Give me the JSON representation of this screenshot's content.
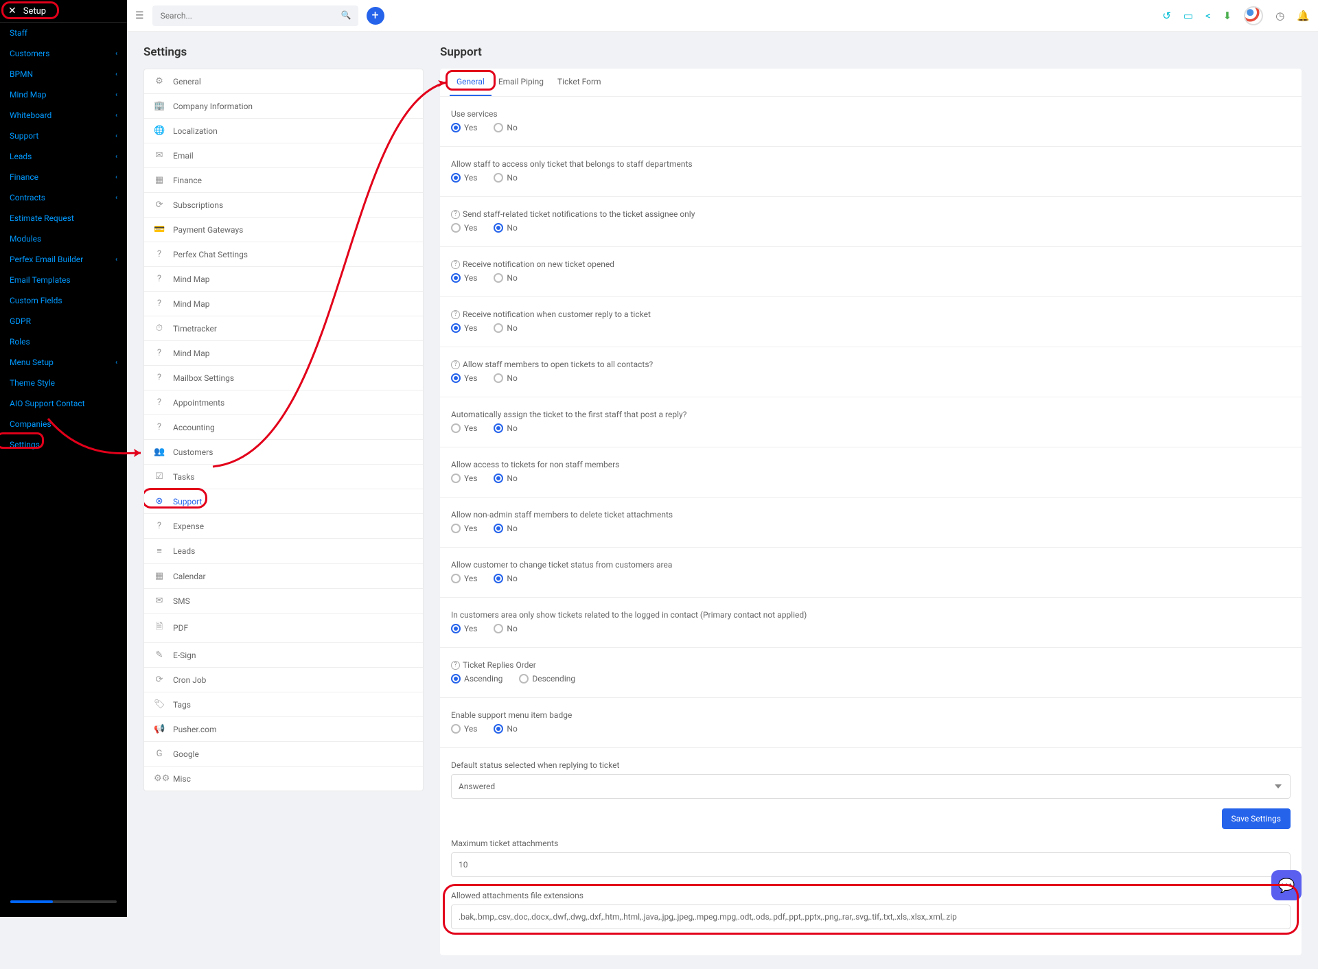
{
  "sidebar": {
    "title": "Setup",
    "items": [
      {
        "label": "Staff",
        "exp": false
      },
      {
        "label": "Customers",
        "exp": true
      },
      {
        "label": "BPMN",
        "exp": true
      },
      {
        "label": "Mind Map",
        "exp": true
      },
      {
        "label": "Whiteboard",
        "exp": true
      },
      {
        "label": "Support",
        "exp": true
      },
      {
        "label": "Leads",
        "exp": true
      },
      {
        "label": "Finance",
        "exp": true
      },
      {
        "label": "Contracts",
        "exp": true
      },
      {
        "label": "Estimate Request",
        "exp": false
      },
      {
        "label": "Modules",
        "exp": false
      },
      {
        "label": "Perfex Email Builder",
        "exp": true
      },
      {
        "label": "Email Templates",
        "exp": false
      },
      {
        "label": "Custom Fields",
        "exp": false
      },
      {
        "label": "GDPR",
        "exp": false
      },
      {
        "label": "Roles",
        "exp": false
      },
      {
        "label": "Menu Setup",
        "exp": true
      },
      {
        "label": "Theme Style",
        "exp": false
      },
      {
        "label": "AIO Support Contact",
        "exp": false
      },
      {
        "label": "Companies",
        "exp": false
      },
      {
        "label": "Settings",
        "exp": false
      }
    ]
  },
  "topbar": {
    "search_placeholder": "Search..."
  },
  "settings_title": "Settings",
  "settings_menu": [
    {
      "icon": "⚙",
      "label": "General"
    },
    {
      "icon": "🏢",
      "label": "Company Information"
    },
    {
      "icon": "🌐",
      "label": "Localization"
    },
    {
      "icon": "✉",
      "label": "Email"
    },
    {
      "icon": "▦",
      "label": "Finance"
    },
    {
      "icon": "⟳",
      "label": "Subscriptions"
    },
    {
      "icon": "💳",
      "label": "Payment Gateways"
    },
    {
      "icon": "?",
      "label": "Perfex Chat Settings"
    },
    {
      "icon": "?",
      "label": "Mind Map"
    },
    {
      "icon": "?",
      "label": "Mind Map"
    },
    {
      "icon": "⏱",
      "label": "Timetracker"
    },
    {
      "icon": "?",
      "label": "Mind Map"
    },
    {
      "icon": "?",
      "label": "Mailbox Settings"
    },
    {
      "icon": "?",
      "label": "Appointments"
    },
    {
      "icon": "?",
      "label": "Accounting"
    },
    {
      "icon": "👥",
      "label": "Customers"
    },
    {
      "icon": "☑",
      "label": "Tasks"
    },
    {
      "icon": "⊗",
      "label": "Support",
      "active": true
    },
    {
      "icon": "?",
      "label": "Expense"
    },
    {
      "icon": "≡",
      "label": "Leads"
    },
    {
      "icon": "▦",
      "label": "Calendar"
    },
    {
      "icon": "✉",
      "label": "SMS"
    },
    {
      "icon": "🗎",
      "label": "PDF"
    },
    {
      "icon": "✎",
      "label": "E-Sign"
    },
    {
      "icon": "⟳",
      "label": "Cron Job"
    },
    {
      "icon": "🏷",
      "label": "Tags"
    },
    {
      "icon": "📢",
      "label": "Pusher.com"
    },
    {
      "icon": "G",
      "label": "Google"
    },
    {
      "icon": "⚙⚙",
      "label": "Misc"
    }
  ],
  "support_title": "Support",
  "tabs": [
    {
      "label": "General",
      "active": true
    },
    {
      "label": "Email Piping",
      "active": false
    },
    {
      "label": "Ticket Form",
      "active": false
    }
  ],
  "opts": {
    "yes": "Yes",
    "no": "No"
  },
  "form": [
    {
      "label": "Use services",
      "help": false,
      "value": "yes",
      "sep": true
    },
    {
      "label": "Allow staff to access only ticket that belongs to staff departments",
      "help": false,
      "value": "yes",
      "sep": true
    },
    {
      "label": "Send staff-related ticket notifications to the ticket assignee only",
      "help": true,
      "value": "no",
      "sep": true
    },
    {
      "label": "Receive notification on new ticket opened",
      "help": true,
      "value": "yes",
      "sep": true
    },
    {
      "label": "Receive notification when customer reply to a ticket",
      "help": true,
      "value": "yes",
      "sep": true
    },
    {
      "label": "Allow staff members to open tickets to all contacts?",
      "help": true,
      "value": "yes",
      "sep": true
    },
    {
      "label": "Automatically assign the ticket to the first staff that post a reply?",
      "help": false,
      "value": "no",
      "sep": true
    },
    {
      "label": "Allow access to tickets for non staff members",
      "help": false,
      "value": "no",
      "sep": true
    },
    {
      "label": "Allow non-admin staff members to delete ticket attachments",
      "help": false,
      "value": "no",
      "sep": true
    },
    {
      "label": "Allow customer to change ticket status from customers area",
      "help": false,
      "value": "no",
      "sep": true
    },
    {
      "label": "In customers area only show tickets related to the logged in contact (Primary contact not applied)",
      "help": false,
      "value": "yes",
      "sep": true
    }
  ],
  "replies": {
    "help": true,
    "label": "Ticket Replies Order",
    "asc": "Ascending",
    "desc": "Descending",
    "value": "asc"
  },
  "badge": {
    "label": "Enable support menu item badge",
    "value": "no"
  },
  "status": {
    "label": "Default status selected when replying to ticket",
    "value": "Answered"
  },
  "save_label": "Save Settings",
  "max_att": {
    "label": "Maximum ticket attachments",
    "value": "10"
  },
  "ext": {
    "label": "Allowed attachments file extensions",
    "value": ".bak,.bmp,.csv,.doc,.docx,.dwf,.dwg,.dxf,.htm,.html,.java,.jpg,.jpeg,.mpeg.mpg,.odt,.ods,.pdf,.ppt,.pptx,.png,.rar,.svg,.tif,.txt,.xls,.xlsx,.xml,.zip"
  }
}
